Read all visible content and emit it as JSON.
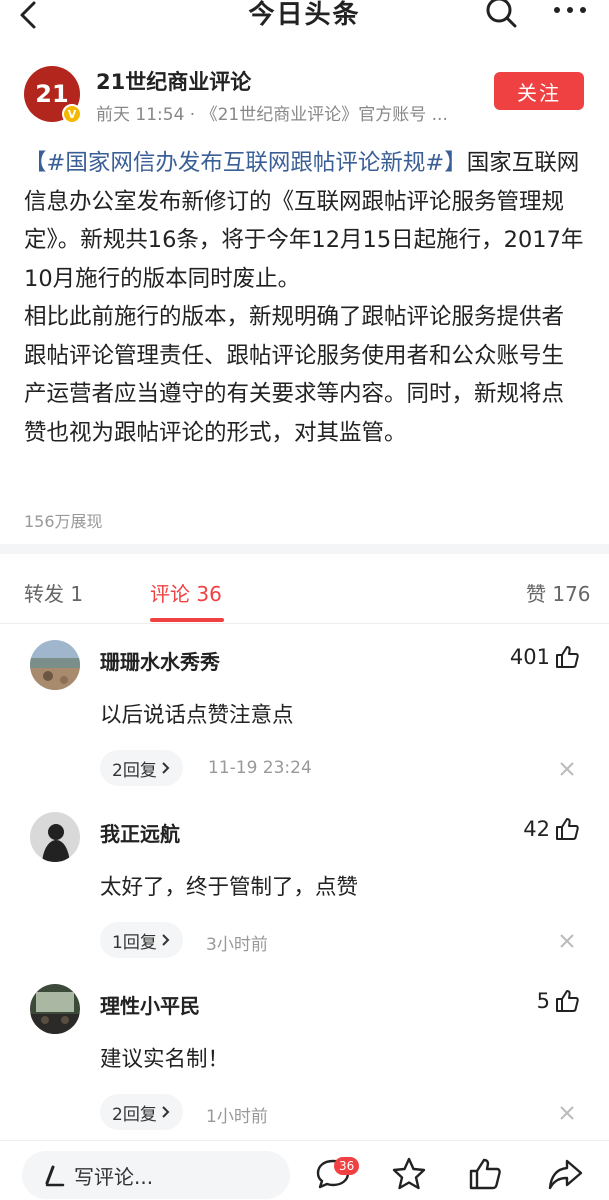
{
  "header": {
    "title": "今日头条"
  },
  "author": {
    "logo_text": "21",
    "name": "21世纪商业评论",
    "meta": "前天  11:54 · 《21世纪商业评论》官方账号 ...",
    "follow_label": "关注"
  },
  "post": {
    "hashtag": "【#国家网信办发布互联网跟帖评论新规#】",
    "paragraph1": "国家互联网信息办公室发布新修订的《互联网跟帖评论服务管理规定》。新规共16条，将于今年12月15日起施行，2017年10月施行的版本同时废止。",
    "paragraph2": "相比此前施行的版本，新规明确了跟帖评论服务提供者跟帖评论管理责任、跟帖评论服务使用者和公众账号生产运营者应当遵守的有关要求等内容。同时，新规将点赞也视为跟帖评论的形式，对其监管。",
    "views": "156万展现"
  },
  "tabs": {
    "repost": "转发 1",
    "comments": "评论 36",
    "likes": "赞 176"
  },
  "comments": [
    {
      "name": "珊珊水水秀秀",
      "likes": "401",
      "text": "以后说话点赞注意点",
      "reply": "2回复",
      "time": "11-19 23:24"
    },
    {
      "name": "我正远航",
      "likes": "42",
      "text": "太好了，终于管制了，点赞",
      "reply": "1回复",
      "time": "3小时前"
    },
    {
      "name": "理性小平民",
      "likes": "5",
      "text": "建议实名制！",
      "reply": "2回复",
      "time": "1小时前"
    }
  ],
  "bottombar": {
    "write_placeholder": "写评论...",
    "comment_count_badge": "36"
  },
  "colors": {
    "accent": "#f04142",
    "hashtag": "#3a5f96",
    "logo": "#b3261e"
  }
}
